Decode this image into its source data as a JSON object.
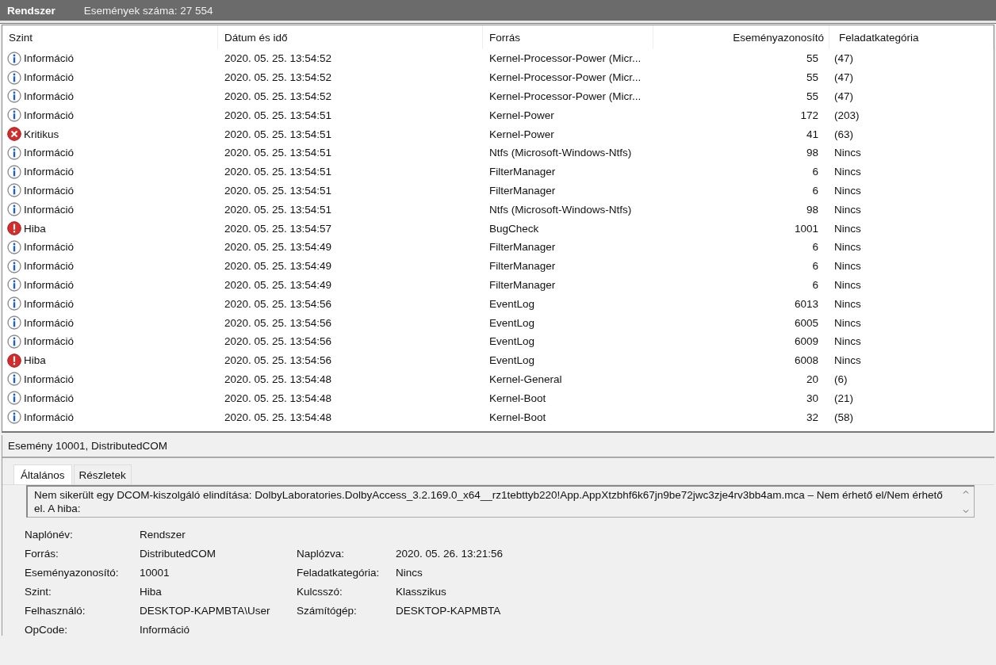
{
  "header": {
    "title": "Rendszer",
    "count": "Események száma: 27 554"
  },
  "table": {
    "columns": [
      "Szint",
      "Dátum és idő",
      "Forrás",
      "Eseményazonosító",
      "Feladatkategória"
    ],
    "rows": [
      {
        "kind": "info",
        "level": "Információ",
        "date": "2020. 05. 25. 13:54:52",
        "source": "Kernel-Processor-Power (Micr...",
        "id": "55",
        "category": "(47)"
      },
      {
        "kind": "info",
        "level": "Információ",
        "date": "2020. 05. 25. 13:54:52",
        "source": "Kernel-Processor-Power (Micr...",
        "id": "55",
        "category": "(47)"
      },
      {
        "kind": "info",
        "level": "Információ",
        "date": "2020. 05. 25. 13:54:52",
        "source": "Kernel-Processor-Power (Micr...",
        "id": "55",
        "category": "(47)"
      },
      {
        "kind": "info",
        "level": "Információ",
        "date": "2020. 05. 25. 13:54:51",
        "source": "Kernel-Power",
        "id": "172",
        "category": "(203)"
      },
      {
        "kind": "critical",
        "level": "Kritikus",
        "date": "2020. 05. 25. 13:54:51",
        "source": "Kernel-Power",
        "id": "41",
        "category": "(63)"
      },
      {
        "kind": "info",
        "level": "Információ",
        "date": "2020. 05. 25. 13:54:51",
        "source": "Ntfs (Microsoft-Windows-Ntfs)",
        "id": "98",
        "category": "Nincs"
      },
      {
        "kind": "info",
        "level": "Információ",
        "date": "2020. 05. 25. 13:54:51",
        "source": "FilterManager",
        "id": "6",
        "category": "Nincs"
      },
      {
        "kind": "info",
        "level": "Információ",
        "date": "2020. 05. 25. 13:54:51",
        "source": "FilterManager",
        "id": "6",
        "category": "Nincs"
      },
      {
        "kind": "info",
        "level": "Információ",
        "date": "2020. 05. 25. 13:54:51",
        "source": "Ntfs (Microsoft-Windows-Ntfs)",
        "id": "98",
        "category": "Nincs"
      },
      {
        "kind": "error",
        "level": "Hiba",
        "date": "2020. 05. 25. 13:54:57",
        "source": "BugCheck",
        "id": "1001",
        "category": "Nincs"
      },
      {
        "kind": "info",
        "level": "Információ",
        "date": "2020. 05. 25. 13:54:49",
        "source": "FilterManager",
        "id": "6",
        "category": "Nincs"
      },
      {
        "kind": "info",
        "level": "Információ",
        "date": "2020. 05. 25. 13:54:49",
        "source": "FilterManager",
        "id": "6",
        "category": "Nincs"
      },
      {
        "kind": "info",
        "level": "Információ",
        "date": "2020. 05. 25. 13:54:49",
        "source": "FilterManager",
        "id": "6",
        "category": "Nincs"
      },
      {
        "kind": "info",
        "level": "Információ",
        "date": "2020. 05. 25. 13:54:56",
        "source": "EventLog",
        "id": "6013",
        "category": "Nincs"
      },
      {
        "kind": "info",
        "level": "Információ",
        "date": "2020. 05. 25. 13:54:56",
        "source": "EventLog",
        "id": "6005",
        "category": "Nincs"
      },
      {
        "kind": "info",
        "level": "Információ",
        "date": "2020. 05. 25. 13:54:56",
        "source": "EventLog",
        "id": "6009",
        "category": "Nincs"
      },
      {
        "kind": "error",
        "level": "Hiba",
        "date": "2020. 05. 25. 13:54:56",
        "source": "EventLog",
        "id": "6008",
        "category": "Nincs"
      },
      {
        "kind": "info",
        "level": "Információ",
        "date": "2020. 05. 25. 13:54:48",
        "source": "Kernel-General",
        "id": "20",
        "category": "(6)"
      },
      {
        "kind": "info",
        "level": "Információ",
        "date": "2020. 05. 25. 13:54:48",
        "source": "Kernel-Boot",
        "id": "30",
        "category": "(21)"
      },
      {
        "kind": "info",
        "level": "Információ",
        "date": "2020. 05. 25. 13:54:48",
        "source": "Kernel-Boot",
        "id": "32",
        "category": "(58)"
      }
    ]
  },
  "details": {
    "title": "Esemény 10001, DistributedCOM",
    "tabs": [
      {
        "label": "Általános",
        "selected": true
      },
      {
        "label": "Részletek",
        "selected": false
      }
    ],
    "message": "Nem sikerült egy DCOM-kiszolgáló elindítása: DolbyLaboratories.DolbyAccess_3.2.169.0_x64__rz1tebttyb220!App.AppXtzbhf6k67jn9be72jwc3zje4rv3bb4am.mca – Nem érhető el/Nem érhető el. A hiba:",
    "fields": [
      {
        "left": {
          "label": "Naplónév:",
          "value": "Rendszer"
        }
      },
      {
        "left": {
          "label": "Forrás:",
          "value": "DistributedCOM"
        },
        "right": {
          "label": "Naplózva:",
          "value": "2020. 05. 26. 13:21:56"
        }
      },
      {
        "left": {
          "label": "Eseményazonosító:",
          "value": "10001"
        },
        "right": {
          "label": "Feladatkategória:",
          "value": "Nincs"
        }
      },
      {
        "left": {
          "label": "Szint:",
          "value": "Hiba"
        },
        "right": {
          "label": "Kulcsszó:",
          "value": "Klasszikus"
        }
      },
      {
        "left": {
          "label": "Felhasználó:",
          "value": "DESKTOP-KAPMBTA\\User"
        },
        "right": {
          "label": "Számítógép:",
          "value": "DESKTOP-KAPMBTA"
        }
      },
      {
        "left": {
          "label": "OpCode:",
          "value": "Információ"
        }
      }
    ]
  }
}
